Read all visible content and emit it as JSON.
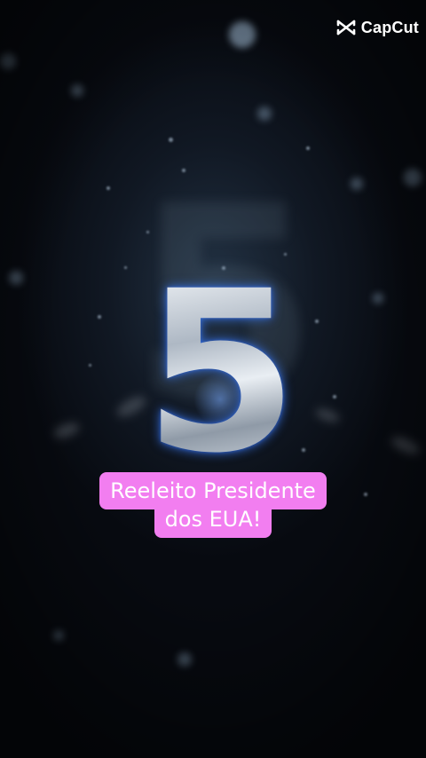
{
  "watermark": {
    "icon": "capcut-logo-icon",
    "label": "CapCut"
  },
  "countdown": {
    "number": "5"
  },
  "caption": {
    "line1": "Reeleito Presidente",
    "line2": "dos EUA!",
    "background_color": "#f27ef0",
    "text_color": "#ffffff"
  }
}
